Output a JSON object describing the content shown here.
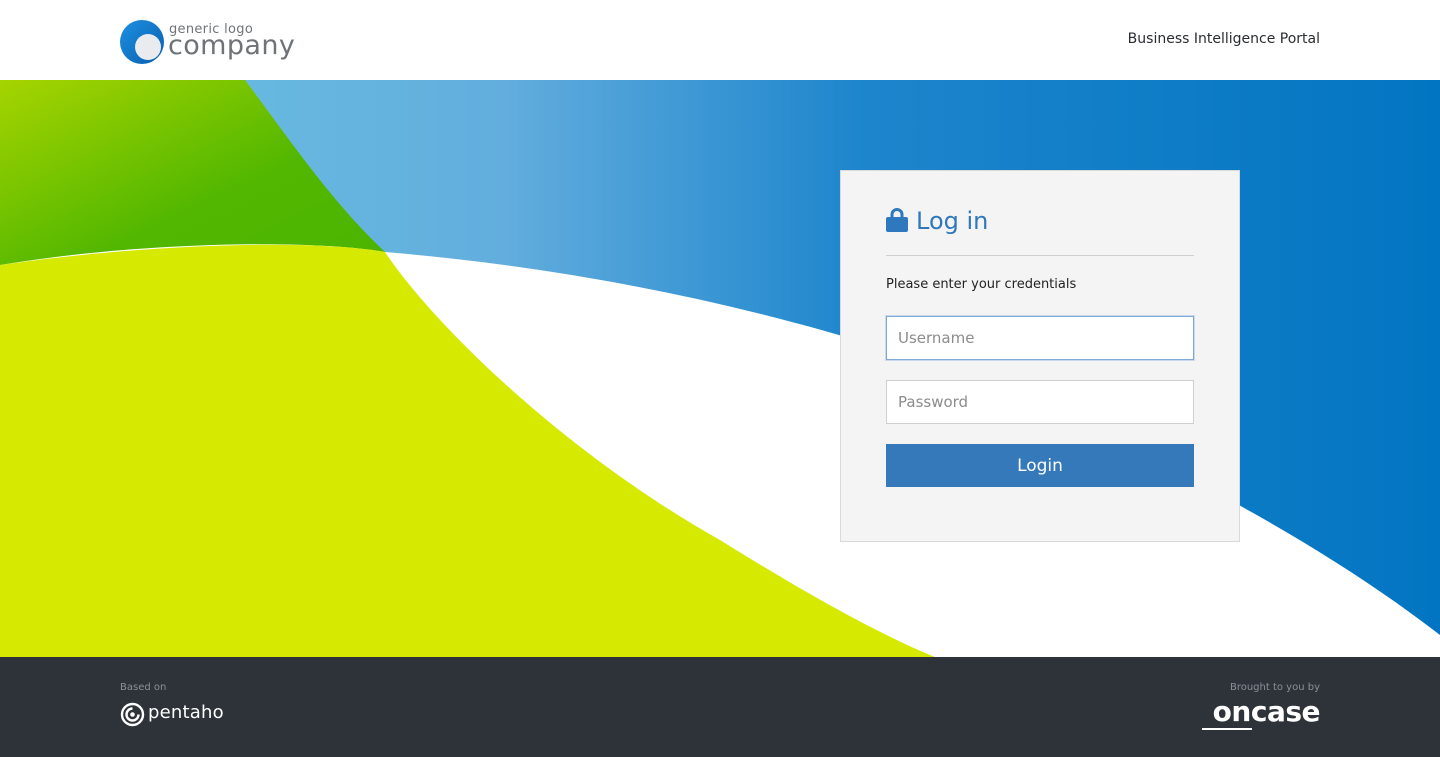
{
  "header": {
    "logo_small": "generic logo",
    "logo_big": "company",
    "portal_title": "Business Intelligence Portal"
  },
  "login": {
    "title": "Log in",
    "subtitle": "Please enter your credentials",
    "username_placeholder": "Username",
    "username_value": "",
    "password_placeholder": "Password",
    "password_value": "",
    "button_label": "Login",
    "icon": "lock-icon"
  },
  "footer": {
    "based_on": "Based on",
    "pentaho_logo": "pentaho",
    "brought_to_you_by": "Brought to you by",
    "oncase_logo": "oncase"
  },
  "colors": {
    "accent": "#3679bb",
    "title": "#2f78be",
    "footer_bg": "#2e333a",
    "lime": "#d6e900",
    "green": "#5cbf00",
    "blue": "#0277c1"
  }
}
